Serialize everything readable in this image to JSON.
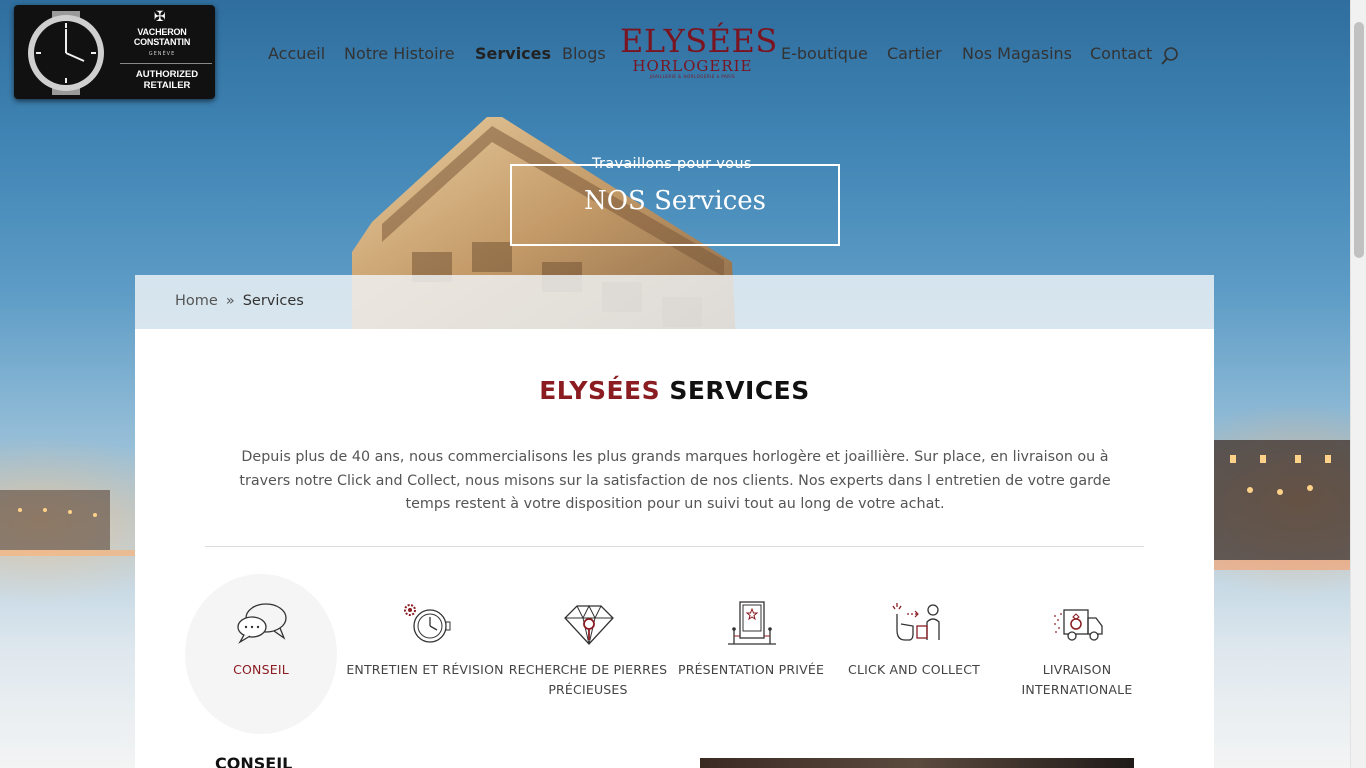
{
  "header": {
    "retailer_badge": {
      "brand": "VACHERON CONSTANTIN",
      "city": "GENÈVE",
      "status": "AUTHORIZED RETAILER"
    },
    "nav_left": [
      "Accueil",
      "Notre Histoire",
      "Services",
      "Blogs"
    ],
    "nav_right": [
      "E-boutique",
      "Cartier",
      "Nos Magasins",
      "Contact"
    ],
    "active_item": "Services",
    "brand": {
      "name": "ELYSÉES",
      "subtitle": "HORLOGERIE",
      "tagline": "JOAILLERIE & HORLOGERIE à PARIS"
    },
    "search_icon": "search-icon"
  },
  "hero": {
    "kicker": "Travaillons pour vous",
    "title": "NOS Services"
  },
  "breadcrumb": {
    "home": "Home",
    "separator": "»",
    "current": "Services"
  },
  "main": {
    "title_accent": "ELYSÉES",
    "title_rest": "SERVICES",
    "intro": "Depuis plus de 40 ans, nous commercialisons les plus grands marques horlogère et joaillière. Sur place, en livraison ou à travers notre Click and Collect, nous misons sur la satisfaction de nos clients. Nos experts dans l entretien de votre garde temps restent à votre disposition pour un suivi tout au long de votre achat.",
    "services": [
      {
        "label": "CONSEIL",
        "icon": "chat-bubbles-icon",
        "active": true
      },
      {
        "label": "ENTRETIEN ET RÉVISION",
        "icon": "watch-gear-icon",
        "active": false
      },
      {
        "label": "RECHERCHE DE PIERRES PRÉCIEUSES",
        "icon": "diamond-icon",
        "active": false
      },
      {
        "label": "PRÉSENTATION PRIVÉE",
        "icon": "display-case-icon",
        "active": false
      },
      {
        "label": "CLICK AND COLLECT",
        "icon": "click-collect-icon",
        "active": false
      },
      {
        "label": "LIVRAISON INTERNATIONALE",
        "icon": "delivery-truck-icon",
        "active": false
      }
    ],
    "sub_title": "CONSEIL"
  },
  "colors": {
    "accent": "#8a1c22",
    "brand": "#7a1420",
    "text": "#555555"
  }
}
